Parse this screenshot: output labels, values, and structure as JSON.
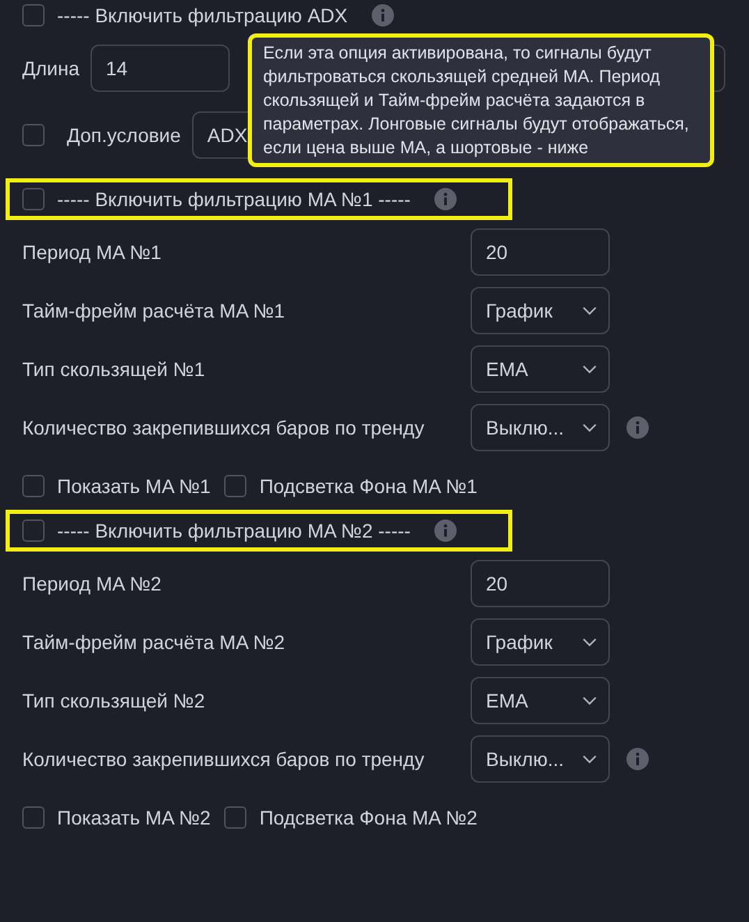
{
  "adx_section": {
    "header": {
      "label": "----- Включить фильтрацию ADX",
      "checked": false,
      "info": true
    },
    "length": {
      "label": "Длина",
      "value": "14"
    },
    "extra_condition": {
      "label": "Доп.условие",
      "checked": false,
      "value": "ADX"
    }
  },
  "tooltip": {
    "text": "Если эта опция активирована, то сигналы будут фильтроваться скользящей средней MA. Период скользящей и Тайм-фрейм расчёта задаются в параметрах. Лонговые сигналы будут отображаться, если цена выше MA, а шортовые - ниже",
    "highlighted": true
  },
  "ma_sections": [
    {
      "header": {
        "label": "----- Включить фильтрацию MA №1 -----",
        "checked": false,
        "info": true,
        "highlighted": true
      },
      "rows": [
        {
          "kind": "input",
          "label": "Период MA №1",
          "value": "20",
          "info": false
        },
        {
          "kind": "select",
          "label": "Тайм-фрейм расчёта MA №1",
          "value": "График",
          "info": false
        },
        {
          "kind": "select",
          "label": "Тип скользящей №1",
          "value": "EMA",
          "info": false
        },
        {
          "kind": "select",
          "label": "Количество закрепившихся баров по тренду",
          "value": "Выклю...",
          "info": true
        }
      ],
      "toggles": [
        {
          "label": "Показать MA №1",
          "checked": false
        },
        {
          "label": "Подсветка Фона MA №1",
          "checked": false
        }
      ]
    },
    {
      "header": {
        "label": "----- Включить фильтрацию MA №2 -----",
        "checked": false,
        "info": true,
        "highlighted": true
      },
      "rows": [
        {
          "kind": "input",
          "label": "Период MA №2",
          "value": "20",
          "info": false
        },
        {
          "kind": "select",
          "label": "Тайм-фрейм расчёта MA №2",
          "value": "График",
          "info": false
        },
        {
          "kind": "select",
          "label": "Тип скользящей №2",
          "value": "EMA",
          "info": false
        },
        {
          "kind": "select",
          "label": "Количество закрепившихся баров по тренду",
          "value": "Выклю...",
          "info": true
        }
      ],
      "toggles": [
        {
          "label": "Показать MA №2",
          "checked": false
        },
        {
          "label": "Подсветка Фона MA №2",
          "checked": false
        }
      ]
    }
  ]
}
